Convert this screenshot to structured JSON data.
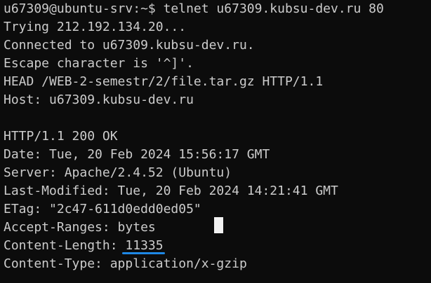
{
  "terminal": {
    "lines": [
      "u67309@ubuntu-srv:~$ telnet u67309.kubsu-dev.ru 80",
      "Trying 212.192.134.20...",
      "Connected to u67309.kubsu-dev.ru.",
      "Escape character is '^]'.",
      "HEAD /WEB-2-semestr/2/file.tar.gz HTTP/1.1",
      "Host: u67309.kubsu-dev.ru",
      "",
      "HTTP/1.1 200 OK",
      "Date: Tue, 20 Feb 2024 15:56:17 GMT",
      "Server: Apache/2.4.52 (Ubuntu)",
      "Last-Modified: Tue, 20 Feb 2024 14:21:41 GMT",
      "ETag: \"2c47-611d0edd0ed05\"",
      "Accept-Ranges: bytes",
      "Content-Length: ",
      "Content-Type: application/x-gzip"
    ],
    "content_length_value": "11335",
    "colors": {
      "background": "#0c0c0c",
      "text": "#cccccc",
      "underline": "#1e88e5",
      "cursor": "#f2f2f2"
    }
  }
}
